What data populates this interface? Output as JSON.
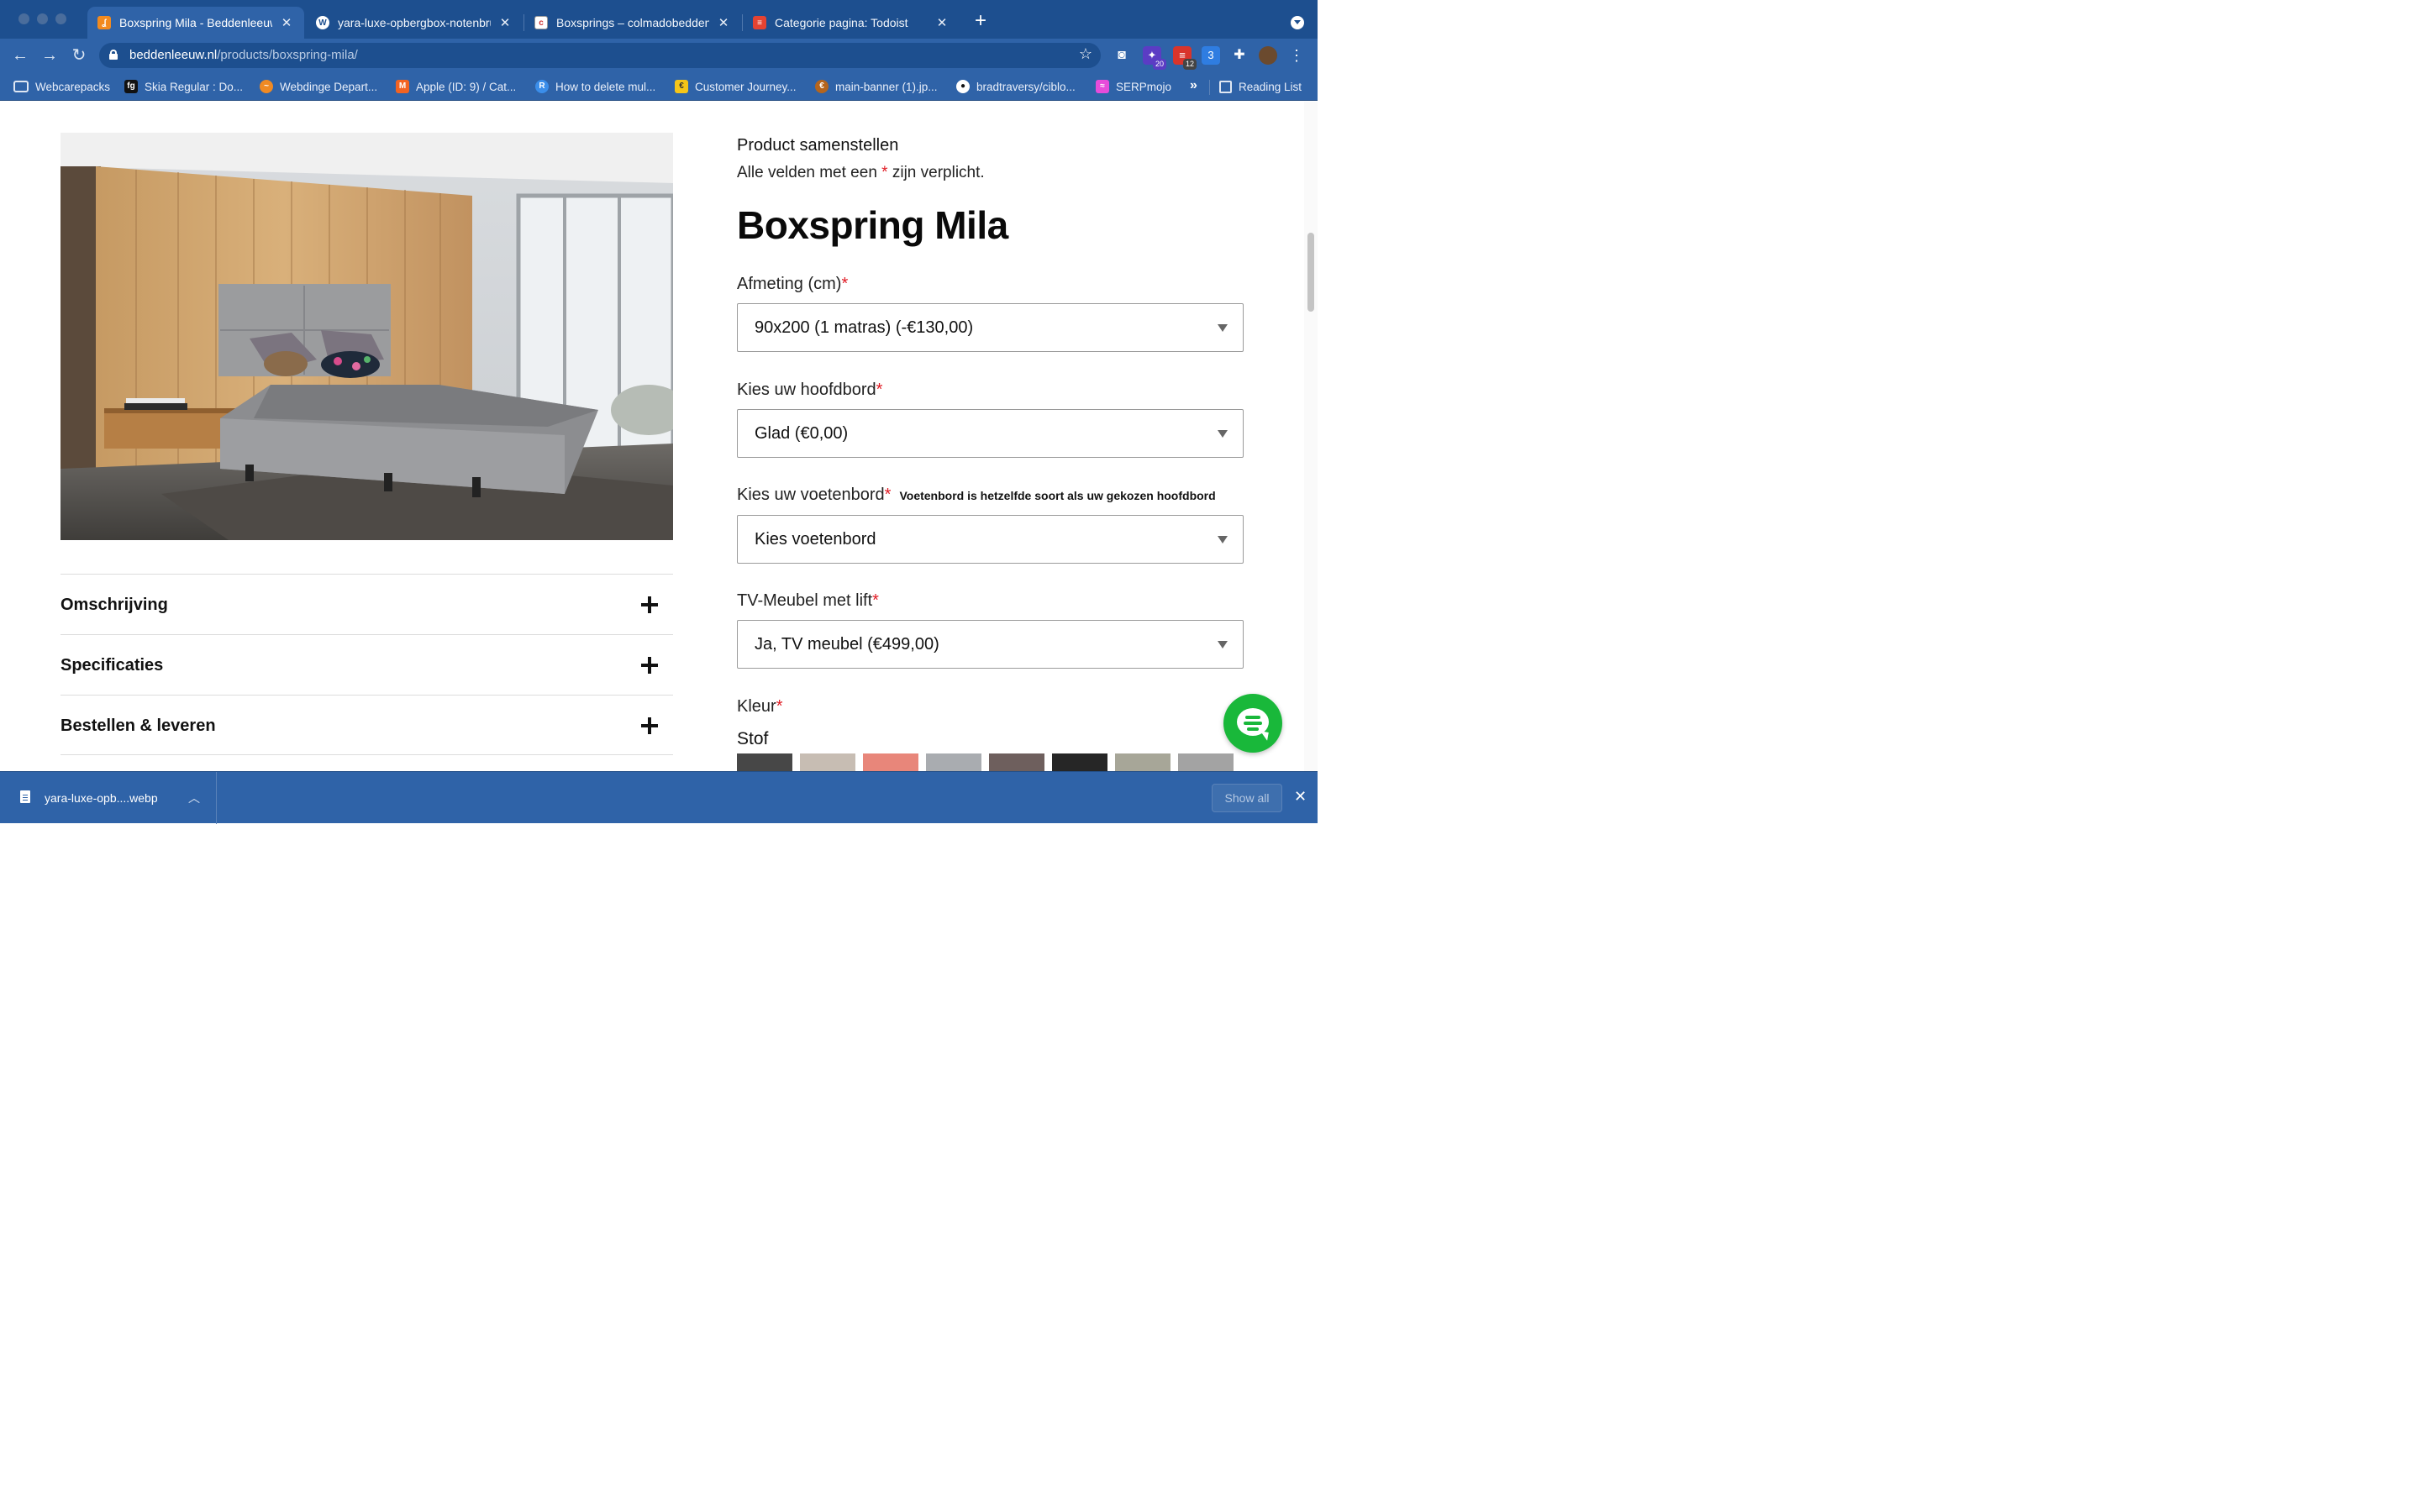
{
  "browser": {
    "tabs": [
      {
        "title": "Boxspring Mila - Beddenleeuw",
        "active": true,
        "favicon": "beddenleeuw-icon",
        "color": "#2f63a8"
      },
      {
        "title": "yara-luxe-opbergbox-notenbru",
        "active": false,
        "favicon": "wordpress-icon",
        "color": "#1d4f8f"
      },
      {
        "title": "Boxsprings – colmadobedden.n",
        "active": false,
        "favicon": "colmado-icon",
        "color": "#1d4f8f"
      },
      {
        "title": "Categorie pagina: Todoist",
        "active": false,
        "favicon": "todoist-icon",
        "color": "#1d4f8f"
      }
    ],
    "url_host": "beddenleeuw.nl",
    "url_path": "/products/boxspring-mila/",
    "extensions": [
      {
        "name": "camera-extension-icon",
        "badge": ""
      },
      {
        "name": "wizard-extension-icon",
        "badge": "20"
      },
      {
        "name": "todoist-extension-icon",
        "badge": "12"
      },
      {
        "name": "calendar-extension-icon",
        "badge": ""
      },
      {
        "name": "puzzle-extensions-icon",
        "badge": ""
      },
      {
        "name": "profile-avatar",
        "badge": ""
      }
    ],
    "bookmarks": [
      {
        "label": "Webcarepacks",
        "icon": "folder-icon"
      },
      {
        "label": "Skia Regular : Do...",
        "icon": "fg-icon"
      },
      {
        "label": "Webdinge Depart...",
        "icon": "webdinge-icon"
      },
      {
        "label": "Apple (ID: 9) / Cat...",
        "icon": "magento-icon"
      },
      {
        "label": "How to delete mul...",
        "icon": "r-icon"
      },
      {
        "label": "Customer Journey...",
        "icon": "journey-icon"
      },
      {
        "label": "main-banner (1).jp...",
        "icon": "banner-icon"
      },
      {
        "label": "bradtraversy/ciblo...",
        "icon": "github-icon"
      },
      {
        "label": "SERPmojo",
        "icon": "serpmojo-icon"
      }
    ],
    "bookmarks_overflow": "»",
    "reading_list": "Reading List"
  },
  "page": {
    "accordion": [
      {
        "label": "Omschrijving"
      },
      {
        "label": "Specificaties"
      },
      {
        "label": "Bestellen & leveren"
      }
    ],
    "config": {
      "heading": "Product samenstellen",
      "note_before": "Alle velden met een ",
      "note_star": "*",
      "note_after": " zijn verplicht.",
      "title": "Boxspring Mila",
      "fields": [
        {
          "label": "Afmeting (cm)",
          "required": "*",
          "hint": "",
          "value": "90x200 (1 matras) (-€130,00)"
        },
        {
          "label": "Kies uw hoofdbord",
          "required": "*",
          "hint": "",
          "value": "Glad (€0,00)"
        },
        {
          "label": "Kies uw voetenbord",
          "required": "*",
          "hint": "Voetenbord is hetzelfde soort als uw gekozen hoofdbord",
          "value": "Kies voetenbord"
        },
        {
          "label": "TV-Meubel met lift",
          "required": "*",
          "hint": "",
          "value": "Ja, TV meubel (€499,00)"
        }
      ],
      "color_label": "Kleur",
      "color_required": "*",
      "fabric_label": "Stof",
      "swatches": [
        "#474747",
        "#c7bdb3",
        "#e8867a",
        "#a9acb0",
        "#6e5f5d",
        "#262626",
        "#a7a698",
        "#a3a3a3"
      ]
    },
    "chat": {
      "icon": "chat-icon",
      "color": "#19b83a"
    }
  },
  "downloads": {
    "file": "yara-luxe-opb....webp",
    "show_all": "Show all"
  }
}
